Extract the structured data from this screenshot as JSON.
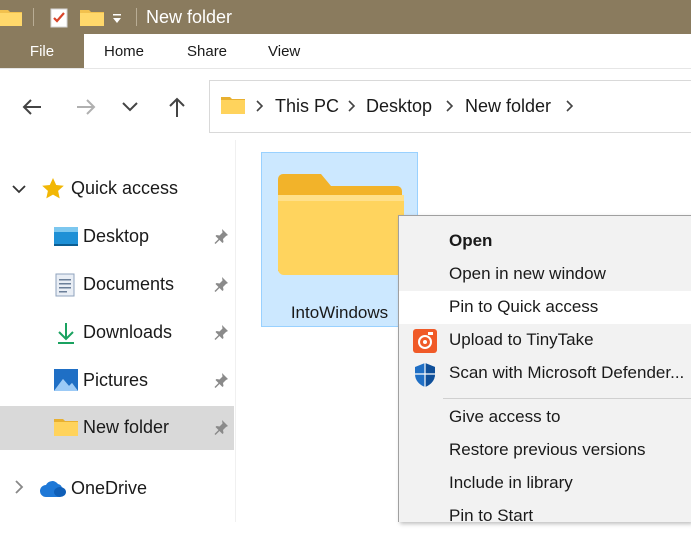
{
  "window": {
    "title": "New folder",
    "quick_access_toolbar": [
      "folder-icon",
      "properties-icon",
      "new-folder-icon",
      "customize-dropdown-icon"
    ]
  },
  "ribbon": {
    "file": "File",
    "tabs": [
      "Home",
      "Share",
      "View"
    ]
  },
  "address": {
    "breadcrumbs": [
      "This PC",
      "Desktop",
      "New folder"
    ]
  },
  "nav_pane": {
    "quick_access": "Quick access",
    "items": [
      {
        "label": "Desktop",
        "icon": "desktop-icon",
        "pinned": true
      },
      {
        "label": "Documents",
        "icon": "documents-icon",
        "pinned": true
      },
      {
        "label": "Downloads",
        "icon": "downloads-icon",
        "pinned": true
      },
      {
        "label": "Pictures",
        "icon": "pictures-icon",
        "pinned": true
      },
      {
        "label": "New folder",
        "icon": "folder-icon",
        "pinned": true,
        "selected": true
      }
    ],
    "onedrive": "OneDrive"
  },
  "content": {
    "folder_name": "IntoWindows"
  },
  "context_menu": {
    "items": [
      {
        "label": "Open",
        "bold": true
      },
      {
        "label": "Open in new window"
      },
      {
        "label": "Pin to Quick access",
        "hovered": true
      },
      {
        "label": "Upload to TinyTake",
        "icon": "tinytake-icon"
      },
      {
        "label": "Scan with Microsoft Defender...",
        "icon": "defender-shield-icon"
      },
      {
        "label": "Give access to",
        "has_submenu": true
      },
      {
        "label": "Restore previous versions"
      },
      {
        "label": "Include in library",
        "has_submenu": true
      },
      {
        "label": "Pin to Start"
      }
    ]
  },
  "colors": {
    "titlebar": "#8a7b5e",
    "selection": "#cce8ff",
    "nav_selected": "#d9d9d9",
    "menu_bg": "#f2f2f2"
  }
}
